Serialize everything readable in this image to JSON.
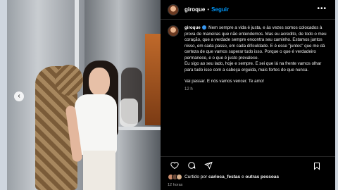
{
  "header": {
    "username": "giroque",
    "separator": "•",
    "follow_label": "Seguir",
    "more_icon": "ellipsis-icon"
  },
  "caption": {
    "username": "giroque",
    "p1": "Nem sempre a vida é justa, e às vezes somos colocados à prova de maneiras que não entendemos. Mas eu acredito, de todo o meu coração, que a verdade sempre encontra seu caminho. Estamos juntos nisso, em cada passo, em cada dificuldade. E é esse \"juntos\" que me dá certeza de que vamos superar tudo isso. Porque o que é verdadeiro permanece, e o que é justo prevalece.",
    "p2": "Eu sigo ao seu lado, hoje e sempre. E sei que lá na frente vamos olhar para tudo isso com a cabeça erguida, mais fortes do que nunca.",
    "p3": "Vai passar. E nós vamos vencer. Te amo!",
    "time": "12 h"
  },
  "actions": {
    "like_icon": "heart-icon",
    "comment_icon": "comment-icon",
    "share_icon": "share-icon",
    "save_icon": "bookmark-icon"
  },
  "likes": {
    "prefix": "Curtido por",
    "user": "carioca_festas",
    "mid": "e",
    "others": "outras pessoas"
  },
  "posted_ago": "12 horas",
  "colors": {
    "accent": "#0095f6",
    "background": "#000000",
    "muted": "#a8a8a8"
  }
}
